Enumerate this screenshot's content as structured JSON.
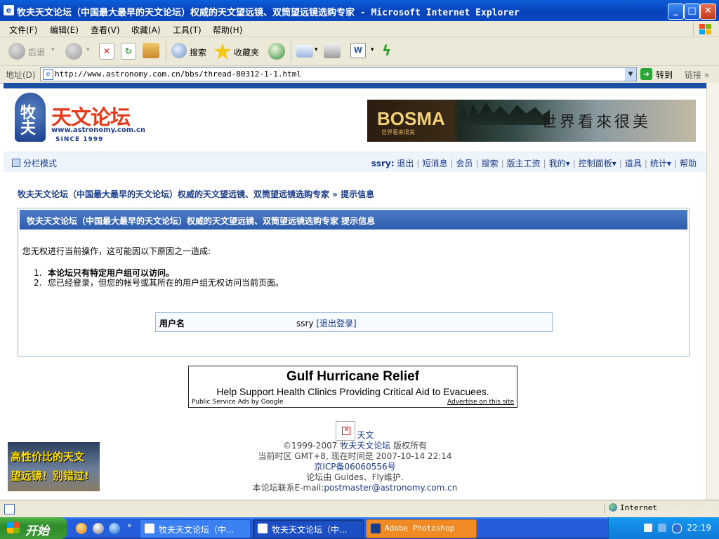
{
  "window": {
    "title": "牧夫天文论坛（中国最大最早的天文论坛）权威的天文望远镜、双筒望远镜选购专家 - Microsoft Internet Explorer",
    "controls": {
      "minimize": "_",
      "maximize": "□",
      "close": "✕"
    }
  },
  "menu": [
    "文件(F)",
    "编辑(E)",
    "查看(V)",
    "收藏(A)",
    "工具(T)",
    "帮助(H)"
  ],
  "toolbar": {
    "back": "后退",
    "search": "搜索",
    "favorites": "收藏夹"
  },
  "address": {
    "label": "地址(D)",
    "url": "http://www.astronomy.com.cn/bbs/thread-80312-1-1.html",
    "go": "转到",
    "links": "链接"
  },
  "site": {
    "logo_text": "天文论坛",
    "logo_mark": "牧夫",
    "logo_url": "www.astronomy.com.cn",
    "logo_since": "SINCE 1999",
    "banner_brand": "BOSMA",
    "banner_sub": "世界看来很美",
    "banner_slogan": "世界看來很美"
  },
  "nav": {
    "mode": "分栏模式",
    "user": "ssry",
    "links": [
      "退出",
      "短消息",
      "会员",
      "搜索",
      "版主工资",
      "我的▾",
      "控制面板▾",
      "道具",
      "统计▾",
      "帮助"
    ]
  },
  "breadcrumb": "牧夫天文论坛（中国最大最早的天文论坛）权威的天文望远镜、双筒望远镜选购专家 » 提示信息",
  "notice": {
    "header": "牧夫天文论坛（中国最大最早的天文论坛）权威的天文望远镜、双筒望远镜选购专家 提示信息",
    "message": "您无权进行当前操作，这可能因以下原因之一造成:",
    "reasons": [
      "本论坛只有特定用户组可以访问。",
      "您已经登录，但您的帐号或其所在的用户组无权访问当前页面。"
    ],
    "username_label": "用户名",
    "username_value": "ssry",
    "logout_link": "[退出登录]"
  },
  "ad": {
    "headline": "Gulf Hurricane Relief",
    "subline": "Help Support Health Clinics Providing Critical Aid to Evacuees.",
    "footer_left": "Public Service Ads by Google",
    "footer_right": "Advertise on this site"
  },
  "footer": {
    "icon_label": "天文",
    "copyright_pre": "©1999-2007",
    "copyright_link": "牧夫天文论坛",
    "copyright_post": "版权所有",
    "timezone": "当前时区 GMT+8, 现在时间是 2007-10-14 22:14",
    "icp": "京ICP备06060556号",
    "maintained": "论坛由 Guides、Fly维护.",
    "contact": "本论坛联系E-mail:",
    "email": "postmaster@astronomy.com.cn"
  },
  "side_ad": {
    "line1": "高性价比的天文",
    "line2": "望远镜！别错过!"
  },
  "status": {
    "zone": "Internet"
  },
  "taskbar": {
    "start": "开始",
    "tasks": [
      "牧夫天文论坛（中...",
      "牧夫天文论坛（中...",
      "Adobe Photoshop"
    ],
    "clock": "22:19",
    "watermark": "WWW.ASTRONOMY.COM.CN"
  }
}
